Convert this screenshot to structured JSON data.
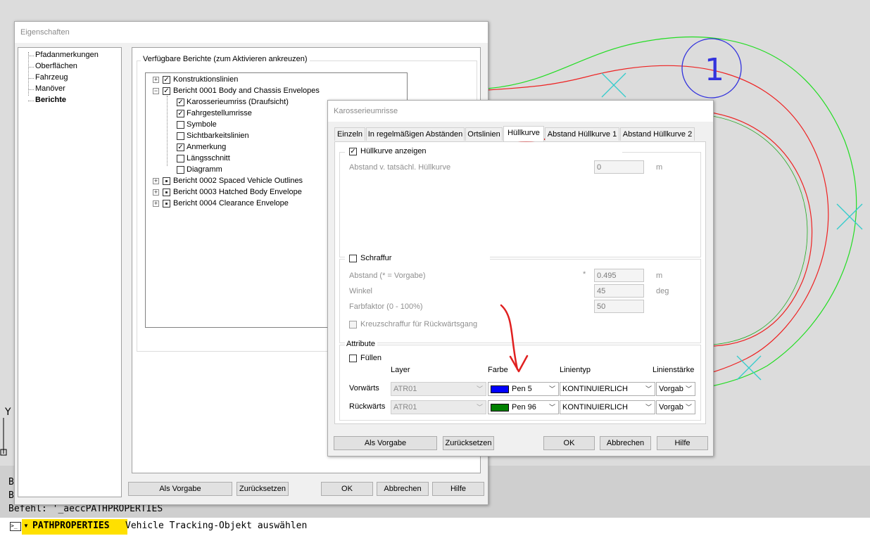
{
  "colors": {
    "green_curve": "#22dd22",
    "red_curve": "#ee2222",
    "blue_circle": "#3333dd",
    "cyan_cross": "#33cccc",
    "pen5": "#0000ff",
    "pen96": "#008000",
    "annotation_red": "#e02020",
    "highlight": "#ffe000"
  },
  "cad": {
    "circle_label": "1",
    "axis_label": "Y"
  },
  "command": {
    "side_letters": [
      "B",
      "B"
    ],
    "history": "Befehl: '_aeccPATHPROPERTIES",
    "command_name": "PATHPROPERTIES",
    "prompt": "Vehicle Tracking-Objekt auswählen"
  },
  "eigenschaften": {
    "title": "Eigenschaften",
    "nav": [
      "Pfadanmerkungen",
      "Oberflächen",
      "Fahrzeug",
      "Manöver",
      "Berichte"
    ],
    "group_label": "Verfügbare Berichte (zum Aktivieren ankreuzen)",
    "tree": [
      {
        "label": "Konstruktionslinien",
        "checked": true
      },
      {
        "label": "Bericht 0001 Body and Chassis Envelopes",
        "checked": true
      },
      {
        "label": "Karosserieumriss (Draufsicht)",
        "checked": true
      },
      {
        "label": "Fahrgestellumrisse",
        "checked": true
      },
      {
        "label": "Symbole",
        "checked": false
      },
      {
        "label": "Sichtbarkeitslinien",
        "checked": false
      },
      {
        "label": "Anmerkung",
        "checked": true
      },
      {
        "label": "Längsschnitt",
        "checked": false
      },
      {
        "label": "Diagramm",
        "checked": false
      },
      {
        "label": "Bericht 0002 Spaced Vehicle Outlines",
        "checked": false
      },
      {
        "label": "Bericht 0003 Hatched Body Envelope",
        "checked": false
      },
      {
        "label": "Bericht 0004 Clearance Envelope",
        "checked": false
      }
    ],
    "buttons": {
      "default": "Als Vorgabe",
      "reset": "Zurücksetzen",
      "ok": "OK",
      "cancel": "Abbrechen",
      "help": "Hilfe"
    }
  },
  "karosserie": {
    "title": "Karosserieumrisse",
    "tabs": [
      "Einzeln",
      "In regelmäßigen Abständen",
      "Ortslinien",
      "Hüllkurve",
      "Abstand Hüllkurve 1",
      "Abstand Hüllkurve 2"
    ],
    "active_tab": "Hüllkurve",
    "show_envelope": "Hüllkurve anzeigen",
    "distance_label": "Abstand v. tatsächl. Hüllkurve",
    "distance_value": "0",
    "distance_unit": "m",
    "hatch": "Schraffur",
    "hatch_distance_label": "Abstand (* = Vorgabe)",
    "hatch_distance_star": "*",
    "hatch_distance_value": "0.495",
    "hatch_distance_unit": "m",
    "angle_label": "Winkel",
    "angle_value": "45",
    "angle_unit": "deg",
    "color_factor_label": "Farbfaktor (0 - 100%)",
    "color_factor_value": "50",
    "crosshatch": "Kreuzschraffur für Rückwärtsgang",
    "attributes": {
      "legend": "Attribute",
      "fill": "Füllen",
      "headers": {
        "layer": "Layer",
        "color": "Farbe",
        "linetype": "Linientyp",
        "lineweight": "Linienstärke"
      },
      "rows": [
        {
          "label": "Vorwärts",
          "layer": "ATR01",
          "color": "Pen 5",
          "linetype": "KONTINUIERLICH",
          "weight": "Vorgab"
        },
        {
          "label": "Rückwärts",
          "layer": "ATR01",
          "color": "Pen 96",
          "linetype": "KONTINUIERLICH",
          "weight": "Vorgab"
        }
      ]
    },
    "buttons": {
      "default": "Als Vorgabe",
      "reset": "Zurücksetzen",
      "ok": "OK",
      "cancel": "Abbrechen",
      "help": "Hilfe"
    }
  }
}
